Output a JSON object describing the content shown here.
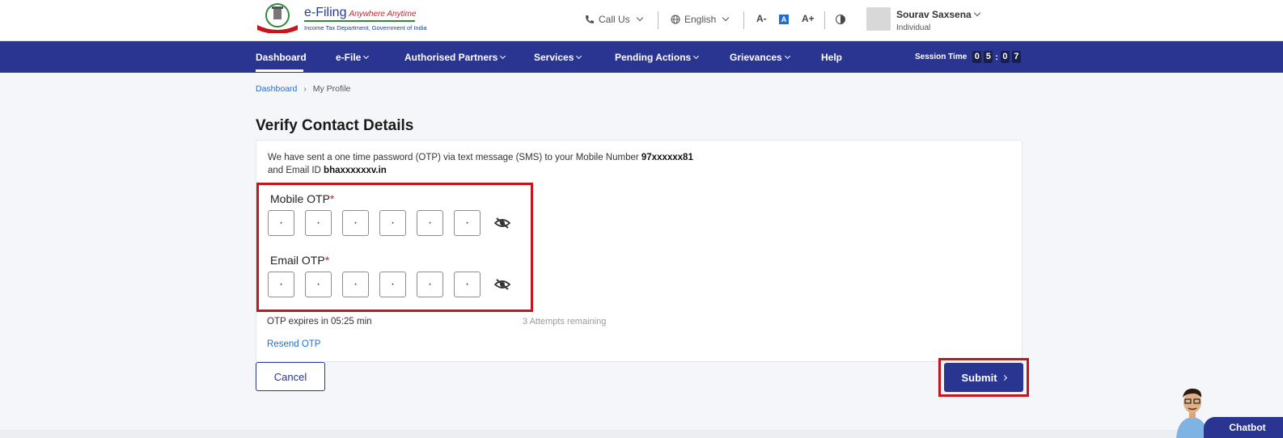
{
  "header": {
    "logo_title": "e-Filing",
    "logo_tagline": "Anywhere Anytime",
    "logo_subtitle": "Income Tax Department, Government of India",
    "call_us": "Call Us",
    "language": "English",
    "font_decrease": "A-",
    "font_default": "A",
    "font_increase": "A+",
    "user_name": "Sourav Saxsena",
    "user_type": "Individual"
  },
  "nav": {
    "items": [
      {
        "label": "Dashboard"
      },
      {
        "label": "e-File"
      },
      {
        "label": "Authorised Partners"
      },
      {
        "label": "Services"
      },
      {
        "label": "Pending Actions"
      },
      {
        "label": "Grievances"
      },
      {
        "label": "Help"
      }
    ],
    "session_label": "Session Time",
    "session_digits": [
      "0",
      "5",
      "0",
      "7"
    ]
  },
  "breadcrumb": {
    "home": "Dashboard",
    "separator": "›",
    "current": "My Profile"
  },
  "page": {
    "title": "Verify Contact Details",
    "info_line1": "We have sent a one time password (OTP) via text message (SMS) to your Mobile Number",
    "mobile_masked": "97xxxxxx81",
    "info_line2": "and Email ID",
    "email_masked": "bhaxxxxxxv.in",
    "mobile_otp_label": "Mobile OTP",
    "email_otp_label": "Email OTP",
    "required_mark": "*",
    "mobile_otp": [
      "·",
      "·",
      "·",
      "·",
      "·",
      "·"
    ],
    "email_otp": [
      "·",
      "·",
      "·",
      "·",
      "·",
      "·"
    ],
    "expires_text": "OTP expires in 05:25 min",
    "attempts_text": "3 Attempts remaining",
    "resend_label": "Resend OTP",
    "cancel_label": "Cancel",
    "submit_label": "Submit"
  },
  "chatbot_label": "Chatbot",
  "colors": {
    "primary": "#2a3591",
    "link": "#1f6fd1",
    "highlight": "#c4161c"
  }
}
